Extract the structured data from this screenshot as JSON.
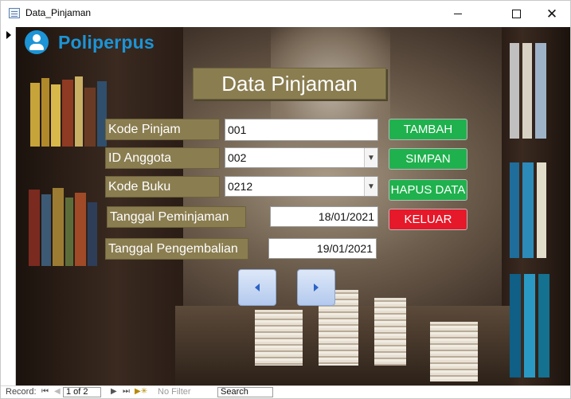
{
  "window": {
    "title": "Data_Pinjaman",
    "controls": {
      "minimize": "",
      "maximize": "",
      "close": "✕"
    }
  },
  "brand": {
    "name": "Poliperpus",
    "color": "#1c94d6",
    "icon": "user-icon"
  },
  "form": {
    "title": "Data Pinjaman",
    "fields": {
      "kode_pinjam": {
        "label": "Kode Pinjam",
        "value": "001"
      },
      "id_anggota": {
        "label": "ID Anggota",
        "value": "002"
      },
      "kode_buku": {
        "label": "Kode Buku",
        "value": "0212"
      },
      "tanggal_peminjaman": {
        "label": "Tanggal Peminjaman",
        "value": "18/01/2021"
      },
      "tanggal_pengembalian": {
        "label": "Tanggal Pengembalian",
        "value": "19/01/2021"
      }
    },
    "buttons": {
      "tambah": "TAMBAH",
      "simpan": "SIMPAN",
      "hapus": "HAPUS DATA",
      "keluar": "KELUAR"
    },
    "colors": {
      "label_bg": "#8a7d50",
      "green": "#1fb14d",
      "red": "#e5192a"
    }
  },
  "statusbar": {
    "record_label": "Record:",
    "first": "⏮",
    "prev": "◀",
    "position": "1 of 2",
    "next": "▶",
    "last": "⏭",
    "new": "▶✳",
    "filter": "No Filter",
    "search": "Search"
  }
}
